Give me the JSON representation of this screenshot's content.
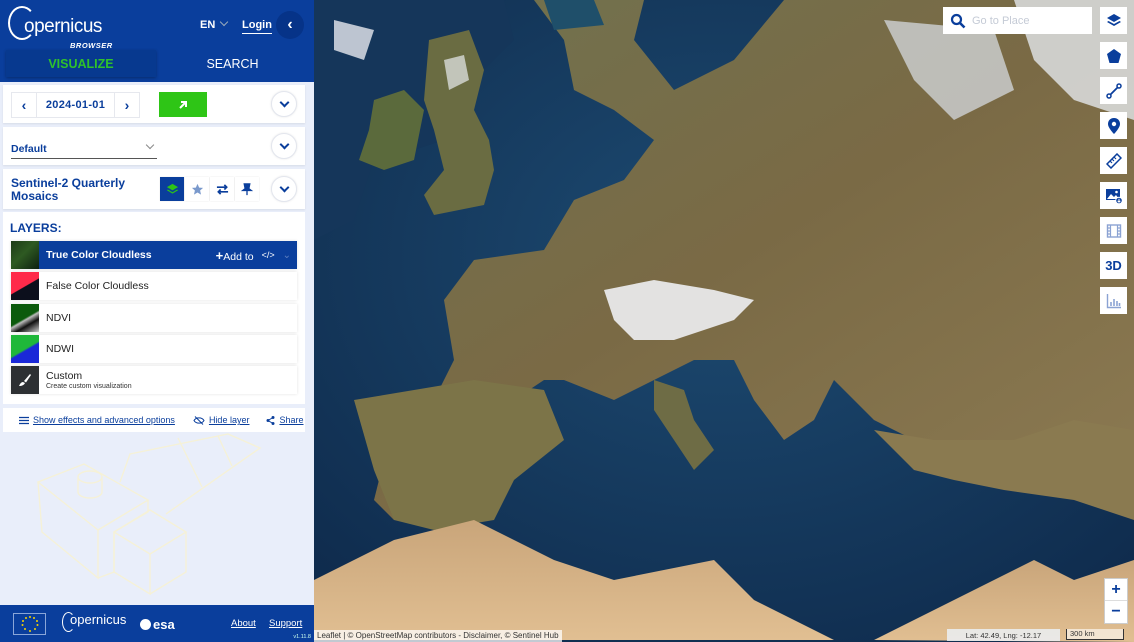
{
  "header": {
    "logo_text": "opernicus",
    "logo_sub": "BROWSER",
    "language": "EN",
    "login_label": "Login",
    "collapse_icon": "chevron-left-icon"
  },
  "tabs": [
    {
      "label": "VISUALIZE",
      "active": true
    },
    {
      "label": "SEARCH",
      "active": false
    }
  ],
  "date_panel": {
    "prev_icon": "chevron-left-icon",
    "date": "2024-01-01",
    "next_icon": "chevron-right-icon",
    "go_icon": "arrow-up-right-icon"
  },
  "theme": {
    "selected": "Default"
  },
  "dataset": {
    "title": "Sentinel-2 Quarterly Mosaics",
    "icons": [
      "layers-icon",
      "star-icon",
      "compare-icon",
      "pin-icon"
    ]
  },
  "layers": {
    "title": "LAYERS:",
    "items": [
      {
        "name": "True Color Cloudless",
        "selected": true
      },
      {
        "name": "False Color Cloudless",
        "selected": false
      },
      {
        "name": "NDVI",
        "selected": false
      },
      {
        "name": "NDWI",
        "selected": false
      },
      {
        "name": "Custom",
        "subtitle": "Create custom visualization",
        "selected": false
      }
    ],
    "add_to_label": "Add to",
    "code_label": "</>"
  },
  "advanced": {
    "effects_label": "Show effects and advanced options",
    "hide_label": "Hide layer",
    "share_label": "Share"
  },
  "footer": {
    "copernicus": "opernicus",
    "esa": "esa",
    "about": "About",
    "support": "Support",
    "version": "v1.11.8"
  },
  "map": {
    "search_placeholder": "Go to Place",
    "tools": [
      "layers-icon",
      "pentagon-icon",
      "line-icon",
      "marker-icon",
      "ruler-icon",
      "image-download-icon",
      "film-icon",
      "3d-icon",
      "histogram-icon"
    ],
    "tool_3d_label": "3D",
    "zoom_in": "+",
    "zoom_out": "−",
    "attribution": "Leaflet | © OpenStreetMap contributors - Disclaimer, © Sentinel Hub",
    "coordinates": "Lat: 42.49, Lng: -12.17",
    "scale": "300 km"
  },
  "colors": {
    "brand_blue": "#0a3e9c",
    "accent_green": "#2ec516",
    "sidebar_bg": "#e9eefa"
  }
}
